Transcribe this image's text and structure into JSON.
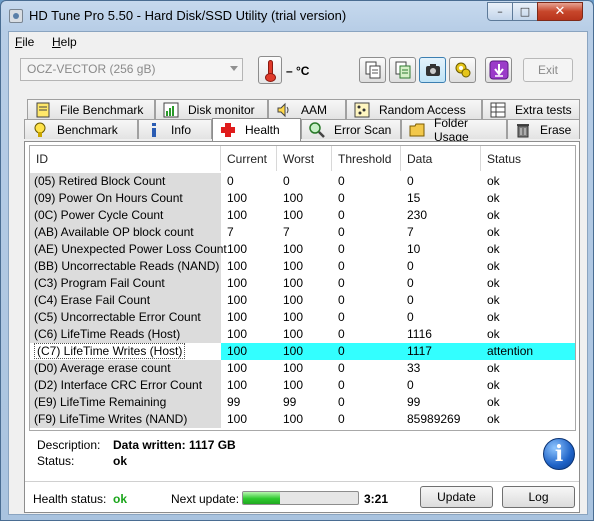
{
  "window": {
    "title": "HD Tune Pro 5.50 - Hard Disk/SSD Utility (trial version)",
    "min_glyph": "–",
    "max_glyph": "□",
    "close_glyph": "✕"
  },
  "menu": [
    {
      "key": "F",
      "rest": "ile"
    },
    {
      "key": "H",
      "rest": "elp"
    }
  ],
  "toolbar": {
    "drive": "OCZ-VECTOR (256 gB)",
    "temperature": "– °C",
    "exit_label": "Exit"
  },
  "tabs": {
    "row1": [
      {
        "label": "File Benchmark",
        "icon": "file-benchmark-icon"
      },
      {
        "label": "Disk monitor",
        "icon": "disk-monitor-icon"
      },
      {
        "label": "AAM",
        "icon": "speaker-icon"
      },
      {
        "label": "Random Access",
        "icon": "random-access-icon"
      },
      {
        "label": "Extra tests",
        "icon": "extra-tests-icon"
      }
    ],
    "row2": [
      {
        "label": "Benchmark",
        "icon": "benchmark-icon"
      },
      {
        "label": "Info",
        "icon": "info-icon"
      },
      {
        "label": "Health",
        "icon": "health-cross-icon"
      },
      {
        "label": "Error Scan",
        "icon": "magnifier-icon"
      },
      {
        "label": "Folder Usage",
        "icon": "folder-icon"
      },
      {
        "label": "Erase",
        "icon": "trash-icon"
      }
    ],
    "active": "Health"
  },
  "smart": {
    "columns": [
      "ID",
      "Current",
      "Worst",
      "Threshold",
      "Data",
      "Status"
    ],
    "rows": [
      [
        "(05) Retired Block Count",
        "0",
        "0",
        "0",
        "0",
        "ok"
      ],
      [
        "(09) Power On Hours Count",
        "100",
        "100",
        "0",
        "15",
        "ok"
      ],
      [
        "(0C) Power Cycle Count",
        "100",
        "100",
        "0",
        "230",
        "ok"
      ],
      [
        "(AB) Available OP block count",
        "7",
        "7",
        "0",
        "7",
        "ok"
      ],
      [
        "(AE) Unexpected Power Loss Count",
        "100",
        "100",
        "0",
        "10",
        "ok"
      ],
      [
        "(BB) Uncorrectable Reads (NAND)",
        "100",
        "100",
        "0",
        "0",
        "ok"
      ],
      [
        "(C3) Program Fail Count",
        "100",
        "100",
        "0",
        "0",
        "ok"
      ],
      [
        "(C4) Erase Fail Count",
        "100",
        "100",
        "0",
        "0",
        "ok"
      ],
      [
        "(C5) Uncorrectable Error Count",
        "100",
        "100",
        "0",
        "0",
        "ok"
      ],
      [
        "(C6) LifeTime Reads (Host)",
        "100",
        "100",
        "0",
        "1116",
        "ok"
      ],
      [
        "(C7) LifeTime Writes (Host)",
        "100",
        "100",
        "0",
        "1117",
        "attention"
      ],
      [
        "(D0) Average erase count",
        "100",
        "100",
        "0",
        "33",
        "ok"
      ],
      [
        "(D2) Interface CRC Error Count",
        "100",
        "100",
        "0",
        "0",
        "ok"
      ],
      [
        "(E9) LifeTime Remaining",
        "99",
        "99",
        "0",
        "99",
        "ok"
      ],
      [
        "(F9) LifeTime Writes (NAND)",
        "100",
        "100",
        "0",
        "85989269",
        "ok"
      ]
    ],
    "selected_row": 10,
    "highlight_color": "#33ffff"
  },
  "details": {
    "description_label": "Description:",
    "description_value": "Data written: 1117 GB",
    "status_label": "Status:",
    "status_value": "ok",
    "info_glyph": "i"
  },
  "footer": {
    "health_label": "Health status:",
    "health_value": "ok",
    "health_color": "#1aa51a",
    "next_update_label": "Next update:",
    "progress_fraction": 0.32,
    "time": "3:21",
    "update_label": "Update",
    "log_label": "Log"
  }
}
